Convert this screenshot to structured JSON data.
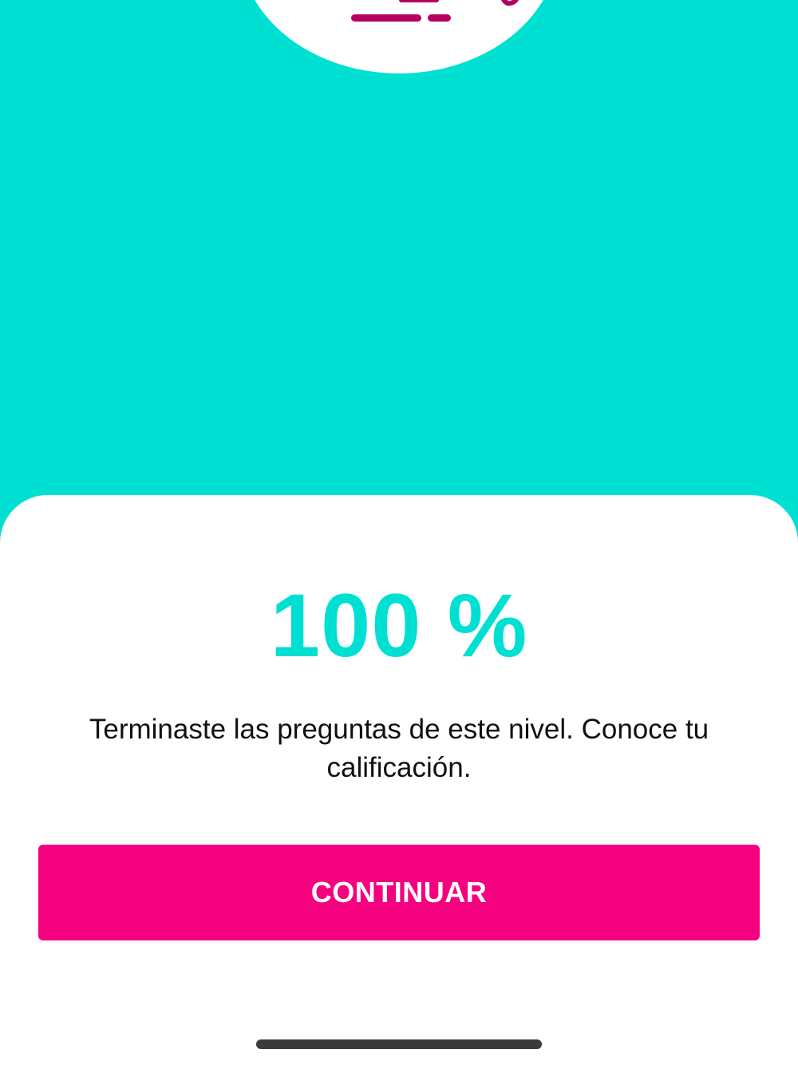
{
  "colors": {
    "background": "#00E0D2",
    "accent_teal": "#00E0D2",
    "button": "#F5007F",
    "illustration": "#B5005F"
  },
  "hero": {
    "illustration_icon": "truck-icon"
  },
  "result": {
    "score": "100 %",
    "message": "Terminaste las preguntas de este nivel. Conoce tu calificación."
  },
  "actions": {
    "continue_label": "CONTINUAR"
  }
}
